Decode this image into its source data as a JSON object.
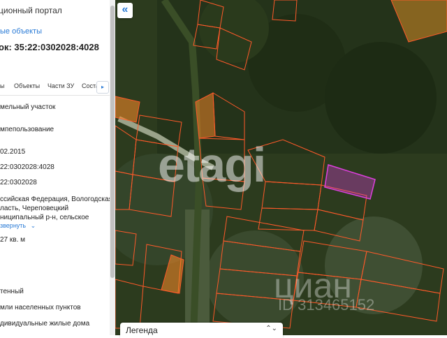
{
  "panel": {
    "portal_title": "ционный портал",
    "near_objects_link": "ые объекты",
    "cadastral_heading": "ок: 35:22:0302028:4028",
    "tabs": [
      "ы",
      "Объекты",
      "Части ЗУ",
      "Соста"
    ],
    "tab_next_icon": "▸",
    "fields": {
      "object_type": "мельный участок",
      "category": "мпепользование",
      "date": "02.2015",
      "cad_number": "22:0302028:4028",
      "cad_quarter": "22:0302028",
      "address_line1": "ссийская Федерация, Вологодская",
      "address_line2": "ласть, Череповецкий",
      "address_line3": "ниципальный р-н, сельское",
      "expand_label": "звернуть",
      "expand_icon": "⌄",
      "area": "27 кв. м",
      "status": "тенный",
      "land_category": "мли населенных пунктов",
      "permitted_use": "дивидуальные жилые дома"
    }
  },
  "map": {
    "collapse_button_icon": "«",
    "legend_label": "Легенда",
    "legend_toggle_icon": "⌃⌄",
    "watermark_etagi": "etagi",
    "watermark_cian": "циан",
    "watermark_cian_id": "ID 313465152",
    "parcel_stroke_color": "#ff5a2a",
    "highlight_color": "#e040e0"
  }
}
